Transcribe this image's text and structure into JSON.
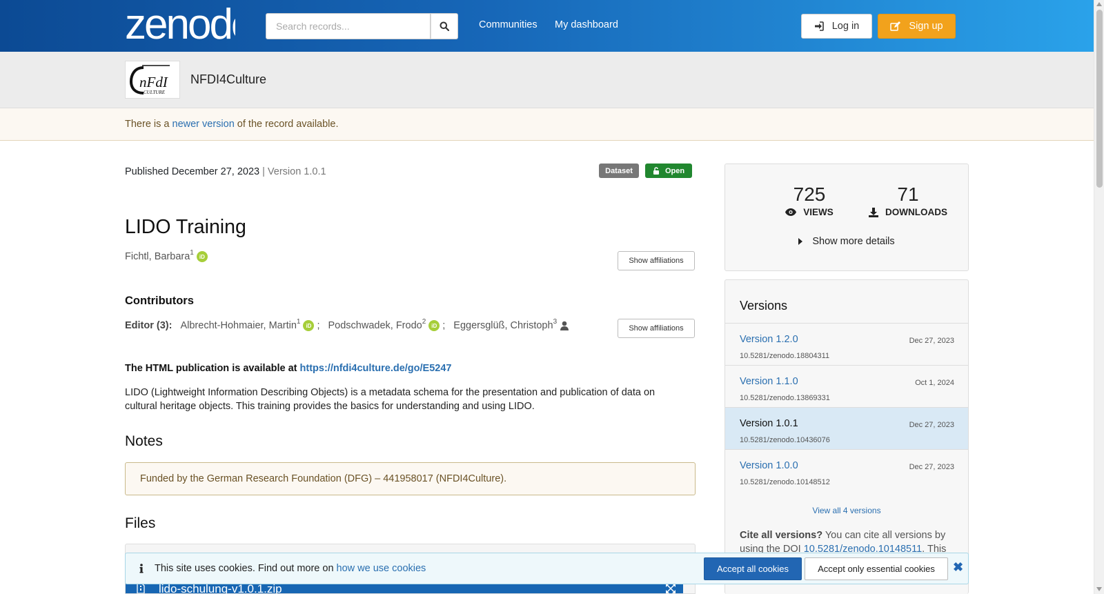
{
  "header": {
    "logo_text": "zenodo",
    "search_placeholder": "Search records...",
    "nav": [
      "Communities",
      "My dashboard"
    ],
    "login_label": "Log in",
    "signup_label": "Sign up"
  },
  "community": {
    "logo_text": "nFdI",
    "logo_subtext": "CULTURE",
    "name": "NFDI4Culture"
  },
  "newer_notice": {
    "prefix": "There is a ",
    "link": "newer version",
    "suffix": " of the record available."
  },
  "record": {
    "published": "Published December 27, 2023",
    "version_text": "| Version 1.0.1",
    "badges": {
      "type": "Dataset",
      "access": "Open"
    },
    "title": "LIDO Training",
    "creator": {
      "name": "Fichtl, Barbara",
      "aff": "1"
    },
    "show_affiliations": "Show affiliations",
    "contributors_heading": "Contributors",
    "editor_label": "Editor (3):",
    "editors": [
      {
        "name": "Albrecht-Hohmaier, Martin",
        "aff": "1",
        "sep": ";"
      },
      {
        "name": "Podschwadek, Frodo",
        "aff": "2",
        "sep": ";"
      },
      {
        "name": "Eggersglüß, Christoph",
        "aff": "3",
        "sep": ""
      }
    ],
    "html_pub_prefix": "The HTML publication is available at ",
    "html_pub_link": "https://nfdi4culture.de/go/E5247",
    "description": "LIDO (Lightweight Information Describing Objects) is a metadata schema for the presentation and publication of data on cultural heritage objects. This training provides the basics for understanding and using LIDO.",
    "notes_heading": "Notes",
    "notes_text": "Funded by the German Research Foundation (DFG) – 441958017 (NFDI4Culture).",
    "files_heading": "Files",
    "file_name": "lido-schulung-v1.0.1.zip"
  },
  "stats": {
    "views": "725",
    "views_label": "VIEWS",
    "downloads": "71",
    "downloads_label": "DOWNLOADS",
    "more_details": "Show more details"
  },
  "versions": {
    "heading": "Versions",
    "items": [
      {
        "label": "Version 1.2.0",
        "date": "Dec 27, 2023",
        "doi": "10.5281/zenodo.18804311",
        "active": false
      },
      {
        "label": "Version 1.1.0",
        "date": "Oct 1, 2024",
        "doi": "10.5281/zenodo.13869331",
        "active": false
      },
      {
        "label": "Version 1.0.1",
        "date": "Dec 27, 2023",
        "doi": "10.5281/zenodo.10436076",
        "active": true
      },
      {
        "label": "Version 1.0.0",
        "date": "Dec 27, 2023",
        "doi": "10.5281/zenodo.10148512",
        "active": false
      }
    ],
    "view_all": "View all 4 versions",
    "cite_bold": "Cite all versions?",
    "cite_text": " You can cite all versions by using the DOI ",
    "cite_doi": "10.5281/zenodo.10148511",
    "cite_suffix": ". This"
  },
  "cookies": {
    "message": "This site uses cookies. Find out more on ",
    "link": "how we use cookies",
    "accept_all": "Accept all cookies",
    "accept_essential": "Accept only essential cookies"
  },
  "colors": {
    "header_start": "#0c4a94",
    "header_end": "#2aa2ea",
    "signup": "#f2a21c",
    "dataset_badge": "#777777",
    "open_badge": "#21872f",
    "link": "#2a6fb0"
  }
}
